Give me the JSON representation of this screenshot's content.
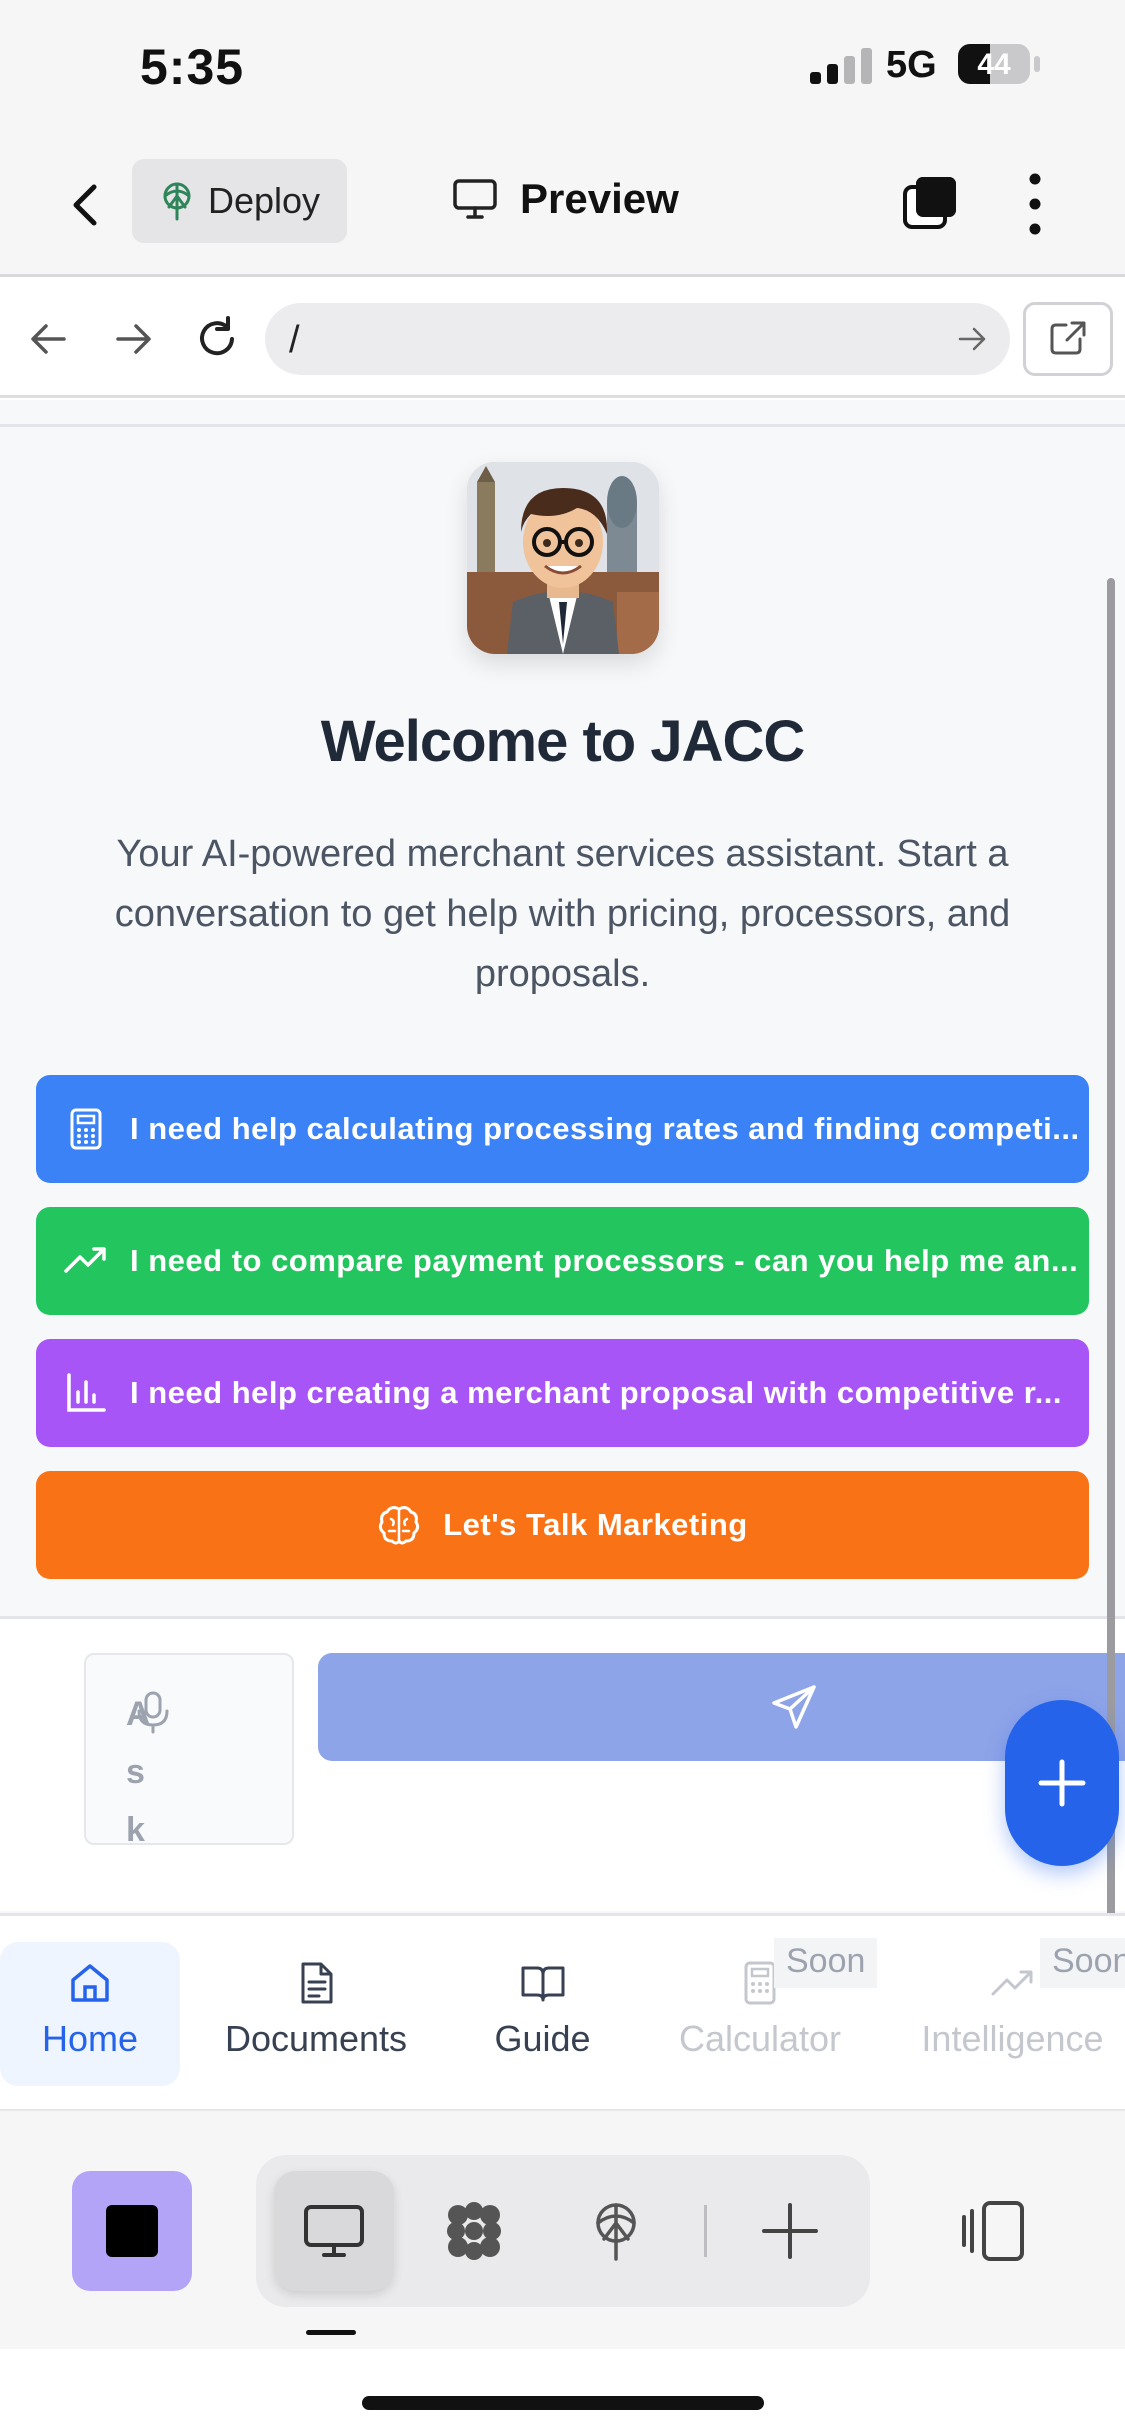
{
  "status_bar": {
    "time": "5:35",
    "network": "5G",
    "battery_level": "44",
    "battery_fraction": 0.44
  },
  "header": {
    "back_icon": "chevron-left-icon",
    "deploy_label": "Deploy",
    "preview_label": "Preview",
    "tabs_icon": "tabs-icon",
    "more_icon": "more-vertical-icon"
  },
  "url_bar": {
    "value": "/",
    "back_icon": "arrow-left-icon",
    "forward_icon": "arrow-right-icon",
    "reload_icon": "reload-icon",
    "open_external_icon": "external-link-icon"
  },
  "welcome": {
    "title": "Welcome to JACC",
    "subtitle": "Your AI-powered merchant services assistant. Start a conversation to get help with pricing, processors, and proposals."
  },
  "quick_actions": [
    {
      "label": "I need help calculating processing rates and finding competi...",
      "icon": "calculator-icon",
      "color": "#3b82f6"
    },
    {
      "label": "I need to compare payment processors - can you help me an...",
      "icon": "trending-up-icon",
      "color": "#22c55e"
    },
    {
      "label": "I need help creating a merchant proposal with competitive r...",
      "icon": "bar-chart-icon",
      "color": "#a855f7"
    },
    {
      "label": "Let's Talk Marketing",
      "icon": "brain-icon",
      "color": "#f97316"
    }
  ],
  "chat_input": {
    "placeholder_visible": "Ask",
    "mic_icon": "mic-icon",
    "send_icon": "send-icon"
  },
  "fab": {
    "icon": "plus-icon"
  },
  "bottom_nav": {
    "items": [
      {
        "label": "Home",
        "icon": "home-icon",
        "active": true
      },
      {
        "label": "Documents",
        "icon": "document-icon"
      },
      {
        "label": "Guide",
        "icon": "book-icon"
      },
      {
        "label": "Calculator",
        "icon": "calculator-icon",
        "disabled": true
      },
      {
        "label": "Intelligence",
        "icon": "trending-up-icon",
        "disabled": true
      }
    ],
    "soon_badge": "Soon"
  },
  "toolbar": {
    "icons": [
      "stop-icon",
      "desktop-icon",
      "workspace-icon",
      "deploy-icon",
      "plus-icon",
      "sidebar-icon"
    ]
  }
}
